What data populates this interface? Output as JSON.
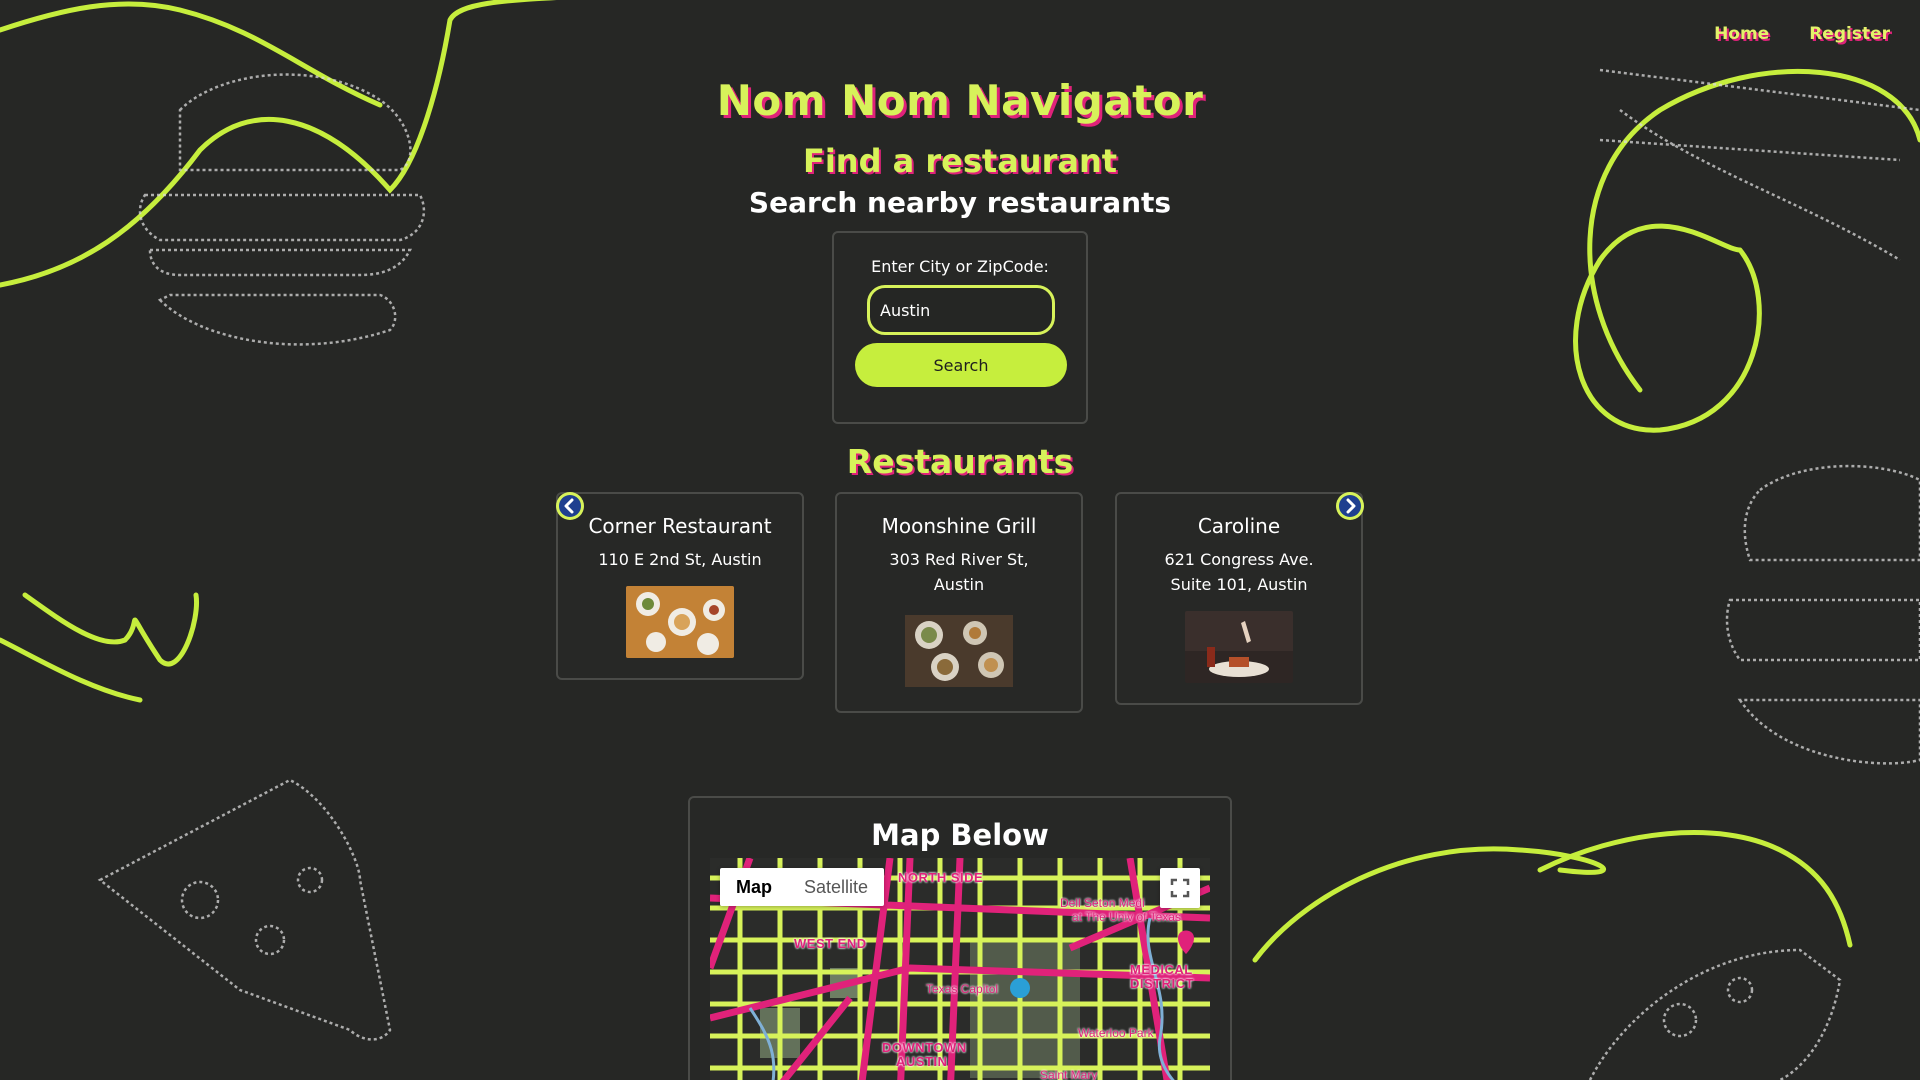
{
  "nav": {
    "home": "Home",
    "register": "Register"
  },
  "header": {
    "app_title": "Nom Nom Navigator"
  },
  "search": {
    "title": "Find a restaurant",
    "subtitle": "Search nearby restaurants",
    "label": "Enter City or ZipCode:",
    "value": "Austin",
    "button": "Search"
  },
  "restaurants": {
    "title": "Restaurants",
    "items": [
      {
        "name": "Corner Restaurant",
        "address": "110 E 2nd St, Austin"
      },
      {
        "name": "Moonshine Grill",
        "address": "303 Red River St, Austin"
      },
      {
        "name": "Caroline",
        "address": "621 Congress Ave. Suite 101, Austin"
      }
    ]
  },
  "map": {
    "title": "Map Below",
    "toggle_map": "Map",
    "toggle_satellite": "Satellite",
    "labels": {
      "north_side": "NORTH SIDE",
      "west_end": "WEST END",
      "medical_district_1": "MEDICAL",
      "medical_district_2": "DISTRICT",
      "hospital_1": "Dell Seton Medi",
      "hospital_2": "at The Univ of Texas",
      "texas_capitol": "Texas Capitol",
      "waterloo_park": "Waterloo Park",
      "downtown_1": "DOWNTOWN",
      "downtown_2": "AUSTIN",
      "saint_mary": "Saint Mary"
    }
  },
  "colors": {
    "accent": "#d7f25a",
    "accent_shadow": "#e0227a",
    "background": "#262725",
    "button": "#c6ee3d"
  }
}
